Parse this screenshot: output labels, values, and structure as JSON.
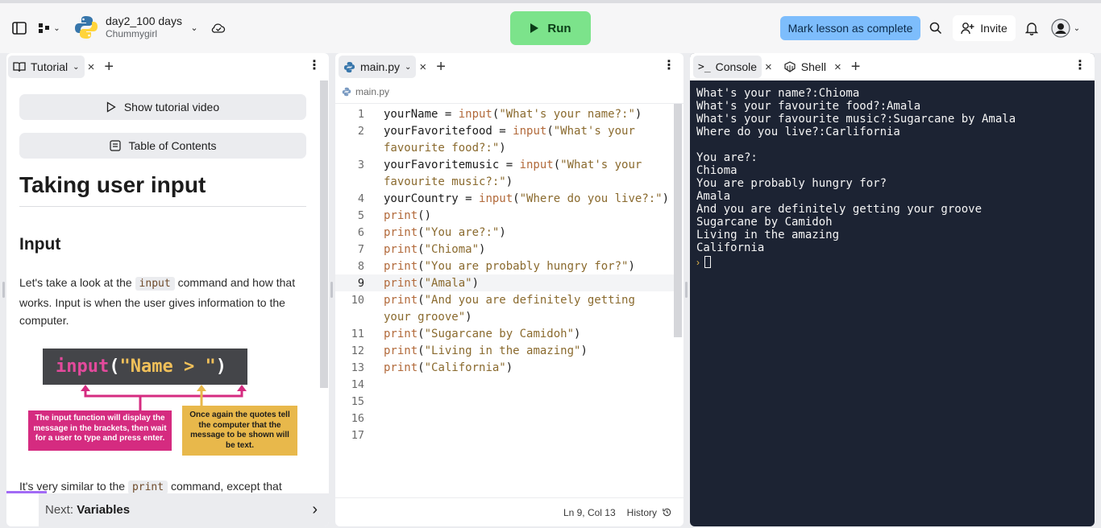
{
  "topbar": {
    "repl_name": "day2_100 days",
    "repl_owner": "Chummygirl",
    "run_label": "Run",
    "mark_complete_label": "Mark lesson as complete",
    "invite_label": "Invite"
  },
  "tutorial_pane": {
    "tab_label": "Tutorial",
    "show_video_label": "Show tutorial video",
    "toc_label": "Table of Contents",
    "heading": "Taking user input",
    "subheading": "Input",
    "para1_before": "Let's take a look at the ",
    "para1_code": "input",
    "para1_after": " command and how that works. Input is when the user gives information to the computer.",
    "diagram": {
      "code_fn": "input",
      "code_open": "(",
      "code_str": "\"Name > \"",
      "code_close": ")",
      "note_left": "The input function will display the message in the brackets, then wait for a user to type and press enter.",
      "note_right": "Once again the quotes tell the computer that the message to be shown will be text."
    },
    "para2_before": "It's very similar to the ",
    "para2_code": "print",
    "para2_after": " command, except that",
    "next_prefix": "Next: ",
    "next_label": "Variables"
  },
  "editor_pane": {
    "tab_label": "main.py",
    "breadcrumb": "main.py",
    "status_cursor": "Ln 9, Col 13",
    "history_label": "History",
    "lines": [
      {
        "n": "1",
        "parts": [
          [
            "",
            "yourName = "
          ],
          [
            "fn",
            "input"
          ],
          [
            "",
            "("
          ],
          [
            "str",
            "\"What's your name?:\""
          ],
          [
            "",
            ")"
          ]
        ]
      },
      {
        "n": "2",
        "parts": [
          [
            "",
            "yourFavoritefood = "
          ],
          [
            "fn",
            "input"
          ],
          [
            "",
            "("
          ],
          [
            "str",
            "\"What's your"
          ]
        ]
      },
      {
        "n": "",
        "parts": [
          [
            "str",
            "favourite food?:\""
          ],
          [
            "",
            ")"
          ]
        ]
      },
      {
        "n": "3",
        "parts": [
          [
            "",
            "yourFavoritemusic = "
          ],
          [
            "fn",
            "input"
          ],
          [
            "",
            "("
          ],
          [
            "str",
            "\"What's your"
          ]
        ]
      },
      {
        "n": "",
        "parts": [
          [
            "str",
            "favourite music?:\""
          ],
          [
            "",
            ")"
          ]
        ]
      },
      {
        "n": "4",
        "parts": [
          [
            "",
            "yourCountry = "
          ],
          [
            "fn",
            "input"
          ],
          [
            "",
            "("
          ],
          [
            "str",
            "\"Where do you live?:\""
          ],
          [
            "",
            ")"
          ]
        ]
      },
      {
        "n": "5",
        "parts": [
          [
            "fn",
            "print"
          ],
          [
            "",
            "()"
          ]
        ]
      },
      {
        "n": "6",
        "parts": [
          [
            "fn",
            "print"
          ],
          [
            "",
            "("
          ],
          [
            "str",
            "\"You are?:\""
          ],
          [
            "",
            ")"
          ]
        ]
      },
      {
        "n": "7",
        "parts": [
          [
            "fn",
            "print"
          ],
          [
            "",
            "("
          ],
          [
            "str",
            "\"Chioma\""
          ],
          [
            "",
            ")"
          ]
        ]
      },
      {
        "n": "8",
        "parts": [
          [
            "fn",
            "print"
          ],
          [
            "",
            "("
          ],
          [
            "str",
            "\"You are probably hungry for?\""
          ],
          [
            "",
            ")"
          ]
        ]
      },
      {
        "n": "9",
        "parts": [
          [
            "fn",
            "print"
          ],
          [
            "",
            "("
          ],
          [
            "str",
            "\"Amala\""
          ],
          [
            "",
            ")"
          ]
        ]
      },
      {
        "n": "10",
        "parts": [
          [
            "fn",
            "print"
          ],
          [
            "",
            "("
          ],
          [
            "str",
            "\"And you are definitely getting"
          ]
        ]
      },
      {
        "n": "",
        "parts": [
          [
            "str",
            "your groove\""
          ],
          [
            "",
            ")"
          ]
        ]
      },
      {
        "n": "11",
        "parts": [
          [
            "fn",
            "print"
          ],
          [
            "",
            "("
          ],
          [
            "str",
            "\"Sugarcane by Camidoh\""
          ],
          [
            "",
            ")"
          ]
        ]
      },
      {
        "n": "12",
        "parts": [
          [
            "fn",
            "print"
          ],
          [
            "",
            "("
          ],
          [
            "str",
            "\"Living in the amazing\""
          ],
          [
            "",
            ")"
          ]
        ]
      },
      {
        "n": "13",
        "parts": [
          [
            "fn",
            "print"
          ],
          [
            "",
            "("
          ],
          [
            "str",
            "\"California\""
          ],
          [
            "",
            ")"
          ]
        ]
      },
      {
        "n": "14",
        "parts": []
      },
      {
        "n": "15",
        "parts": []
      },
      {
        "n": "16",
        "parts": []
      },
      {
        "n": "17",
        "parts": []
      }
    ]
  },
  "console_pane": {
    "console_tab": "Console",
    "shell_tab": "Shell",
    "output": "What's your name?:Chioma\nWhat's your favourite food?:Amala\nWhat's your favourite music?:Sugarcane by Amala\nWhere do you live?:Carlifornia\n\nYou are?:\nChioma\nYou are probably hungry for?\nAmala\nAnd you are definitely getting your groove\nSugarcane by Camidoh\nLiving in the amazing\nCalifornia"
  },
  "colors": {
    "run_bg": "#7ce38b",
    "mark_bg": "#7dbdfc",
    "console_bg": "#1c2333",
    "diagram_pink": "#d52b80",
    "diagram_yellow": "#e8b84b"
  }
}
